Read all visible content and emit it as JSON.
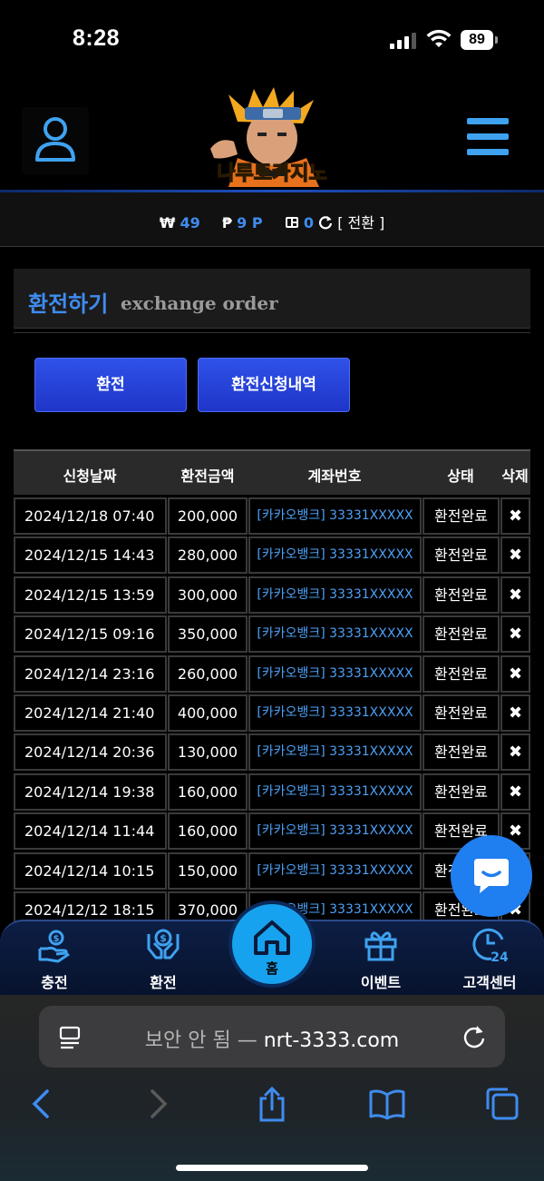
{
  "status": {
    "time": "8:28",
    "battery": "89"
  },
  "header": {
    "logo_text": "나루토카지노"
  },
  "balance": {
    "won_symbol": "₩",
    "won_value": "49",
    "point_symbol": "₱",
    "point_value": "9 P",
    "chip_value": "0",
    "switch_label": "[ 전환 ]"
  },
  "page": {
    "title_ko": "환전하기",
    "title_en": "exchange order"
  },
  "buttons": {
    "exchange": "환전",
    "history": "환전신청내역"
  },
  "table": {
    "headers": {
      "date": "신청날짜",
      "amount": "환전금액",
      "account": "계좌번호",
      "status": "상태",
      "delete": "삭제"
    },
    "rows": [
      {
        "date": "2024/12/18 07:40",
        "amount": "200,000",
        "account": "[카카오뱅크] 33331XXXXX",
        "status": "환전완료",
        "delete": "✖"
      },
      {
        "date": "2024/12/15 14:43",
        "amount": "280,000",
        "account": "[카카오뱅크] 33331XXXXX",
        "status": "환전완료",
        "delete": "✖"
      },
      {
        "date": "2024/12/15 13:59",
        "amount": "300,000",
        "account": "[카카오뱅크] 33331XXXXX",
        "status": "환전완료",
        "delete": "✖"
      },
      {
        "date": "2024/12/15 09:16",
        "amount": "350,000",
        "account": "[카카오뱅크] 33331XXXXX",
        "status": "환전완료",
        "delete": "✖"
      },
      {
        "date": "2024/12/14 23:16",
        "amount": "260,000",
        "account": "[카카오뱅크] 33331XXXXX",
        "status": "환전완료",
        "delete": "✖"
      },
      {
        "date": "2024/12/14 21:40",
        "amount": "400,000",
        "account": "[카카오뱅크] 33331XXXXX",
        "status": "환전완료",
        "delete": "✖"
      },
      {
        "date": "2024/12/14 20:36",
        "amount": "130,000",
        "account": "[카카오뱅크] 33331XXXXX",
        "status": "환전완료",
        "delete": "✖"
      },
      {
        "date": "2024/12/14 19:38",
        "amount": "160,000",
        "account": "[카카오뱅크] 33331XXXXX",
        "status": "환전완료",
        "delete": "✖"
      },
      {
        "date": "2024/12/14 11:44",
        "amount": "160,000",
        "account": "[카카오뱅크] 33331XXXXX",
        "status": "환전완료",
        "delete": "✖"
      },
      {
        "date": "2024/12/14 10:15",
        "amount": "150,000",
        "account": "[카카오뱅크] 33331XXXXX",
        "status": "환전완료",
        "delete": "✖"
      },
      {
        "date": "2024/12/12 18:15",
        "amount": "370,000",
        "account": "[카카오뱅크] 33331XXXXX",
        "status": "환전완료",
        "delete": "✖"
      }
    ]
  },
  "bottom_nav": {
    "deposit": "충전",
    "exchange": "환전",
    "home": "홈",
    "event": "이벤트",
    "support": "고객센터"
  },
  "browser": {
    "insecure": "보안 안 됨",
    "separator": "—",
    "domain": "nrt-3333.com"
  },
  "colors": {
    "accent": "#3f8cf0",
    "button": "#2a45d8",
    "home": "#17a2ef"
  }
}
